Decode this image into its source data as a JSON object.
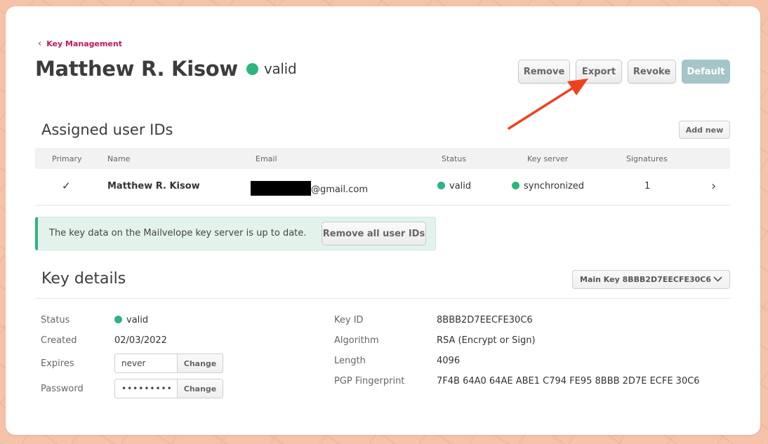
{
  "header": {
    "back_label": "Key Management",
    "name": "Matthew R. Kisow",
    "status": "valid",
    "actions": {
      "remove": "Remove",
      "export": "Export",
      "revoke": "Revoke",
      "default": "Default"
    }
  },
  "user_ids": {
    "title": "Assigned user IDs",
    "add_new": "Add new",
    "columns": [
      "Primary",
      "Name",
      "Email",
      "Status",
      "Key server",
      "Signatures"
    ],
    "rows": [
      {
        "primary": "✓",
        "name": "Matthew R. Kisow",
        "email_suffix": "@gmail.com",
        "status": "valid",
        "key_server": "synchronized",
        "signatures": "1"
      }
    ],
    "alert_text": "The key data on the Mailvelope key server is up to date.",
    "remove_all": "Remove all user IDs"
  },
  "key_details": {
    "title": "Key details",
    "key_select": "Main Key 8BBB2D7EECFE30C6",
    "left": {
      "status_label": "Status",
      "status_value": "valid",
      "created_label": "Created",
      "created_value": "02/03/2022",
      "expires_label": "Expires",
      "expires_value": "never",
      "password_label": "Password",
      "password_value": "•••••••••",
      "change_label": "Change"
    },
    "right": {
      "key_id_label": "Key ID",
      "key_id_value": "8BBB2D7EECFE30C6",
      "algorithm_label": "Algorithm",
      "algorithm_value": "RSA (Encrypt or Sign)",
      "length_label": "Length",
      "length_value": "4096",
      "fingerprint_label": "PGP Fingerprint",
      "fingerprint_value": "7F4B 64A0 64AE ABE1 C794 FE95 8BBB 2D7E ECFE 30C6"
    }
  },
  "colors": {
    "accent": "#c2185b",
    "valid": "#2cb57e",
    "annotation_arrow": "#f0411e",
    "background": "#f4c3a9"
  }
}
